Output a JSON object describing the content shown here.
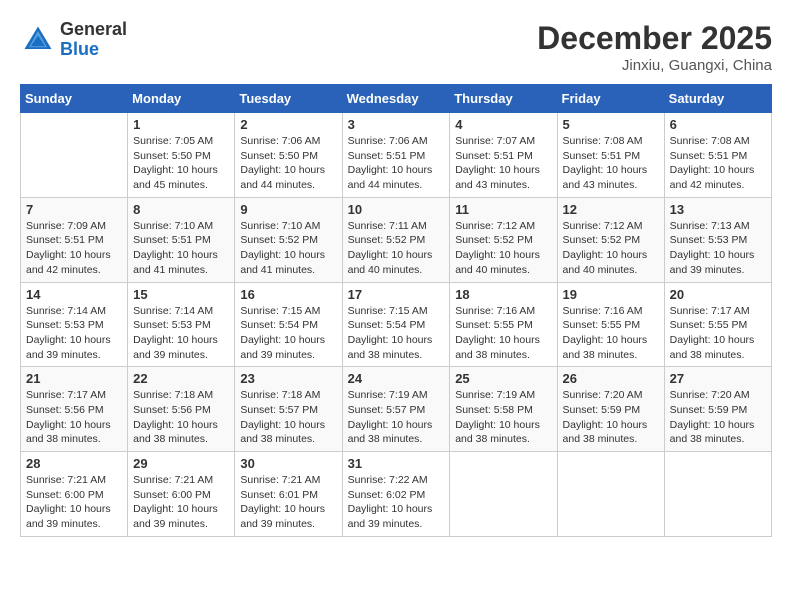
{
  "header": {
    "logo_general": "General",
    "logo_blue": "Blue",
    "month_year": "December 2025",
    "location": "Jinxiu, Guangxi, China"
  },
  "weekdays": [
    "Sunday",
    "Monday",
    "Tuesday",
    "Wednesday",
    "Thursday",
    "Friday",
    "Saturday"
  ],
  "weeks": [
    [
      {
        "day": "",
        "sunrise": "",
        "sunset": "",
        "daylight": ""
      },
      {
        "day": "1",
        "sunrise": "Sunrise: 7:05 AM",
        "sunset": "Sunset: 5:50 PM",
        "daylight": "Daylight: 10 hours and 45 minutes."
      },
      {
        "day": "2",
        "sunrise": "Sunrise: 7:06 AM",
        "sunset": "Sunset: 5:50 PM",
        "daylight": "Daylight: 10 hours and 44 minutes."
      },
      {
        "day": "3",
        "sunrise": "Sunrise: 7:06 AM",
        "sunset": "Sunset: 5:51 PM",
        "daylight": "Daylight: 10 hours and 44 minutes."
      },
      {
        "day": "4",
        "sunrise": "Sunrise: 7:07 AM",
        "sunset": "Sunset: 5:51 PM",
        "daylight": "Daylight: 10 hours and 43 minutes."
      },
      {
        "day": "5",
        "sunrise": "Sunrise: 7:08 AM",
        "sunset": "Sunset: 5:51 PM",
        "daylight": "Daylight: 10 hours and 43 minutes."
      },
      {
        "day": "6",
        "sunrise": "Sunrise: 7:08 AM",
        "sunset": "Sunset: 5:51 PM",
        "daylight": "Daylight: 10 hours and 42 minutes."
      }
    ],
    [
      {
        "day": "7",
        "sunrise": "Sunrise: 7:09 AM",
        "sunset": "Sunset: 5:51 PM",
        "daylight": "Daylight: 10 hours and 42 minutes."
      },
      {
        "day": "8",
        "sunrise": "Sunrise: 7:10 AM",
        "sunset": "Sunset: 5:51 PM",
        "daylight": "Daylight: 10 hours and 41 minutes."
      },
      {
        "day": "9",
        "sunrise": "Sunrise: 7:10 AM",
        "sunset": "Sunset: 5:52 PM",
        "daylight": "Daylight: 10 hours and 41 minutes."
      },
      {
        "day": "10",
        "sunrise": "Sunrise: 7:11 AM",
        "sunset": "Sunset: 5:52 PM",
        "daylight": "Daylight: 10 hours and 40 minutes."
      },
      {
        "day": "11",
        "sunrise": "Sunrise: 7:12 AM",
        "sunset": "Sunset: 5:52 PM",
        "daylight": "Daylight: 10 hours and 40 minutes."
      },
      {
        "day": "12",
        "sunrise": "Sunrise: 7:12 AM",
        "sunset": "Sunset: 5:52 PM",
        "daylight": "Daylight: 10 hours and 40 minutes."
      },
      {
        "day": "13",
        "sunrise": "Sunrise: 7:13 AM",
        "sunset": "Sunset: 5:53 PM",
        "daylight": "Daylight: 10 hours and 39 minutes."
      }
    ],
    [
      {
        "day": "14",
        "sunrise": "Sunrise: 7:14 AM",
        "sunset": "Sunset: 5:53 PM",
        "daylight": "Daylight: 10 hours and 39 minutes."
      },
      {
        "day": "15",
        "sunrise": "Sunrise: 7:14 AM",
        "sunset": "Sunset: 5:53 PM",
        "daylight": "Daylight: 10 hours and 39 minutes."
      },
      {
        "day": "16",
        "sunrise": "Sunrise: 7:15 AM",
        "sunset": "Sunset: 5:54 PM",
        "daylight": "Daylight: 10 hours and 39 minutes."
      },
      {
        "day": "17",
        "sunrise": "Sunrise: 7:15 AM",
        "sunset": "Sunset: 5:54 PM",
        "daylight": "Daylight: 10 hours and 38 minutes."
      },
      {
        "day": "18",
        "sunrise": "Sunrise: 7:16 AM",
        "sunset": "Sunset: 5:55 PM",
        "daylight": "Daylight: 10 hours and 38 minutes."
      },
      {
        "day": "19",
        "sunrise": "Sunrise: 7:16 AM",
        "sunset": "Sunset: 5:55 PM",
        "daylight": "Daylight: 10 hours and 38 minutes."
      },
      {
        "day": "20",
        "sunrise": "Sunrise: 7:17 AM",
        "sunset": "Sunset: 5:55 PM",
        "daylight": "Daylight: 10 hours and 38 minutes."
      }
    ],
    [
      {
        "day": "21",
        "sunrise": "Sunrise: 7:17 AM",
        "sunset": "Sunset: 5:56 PM",
        "daylight": "Daylight: 10 hours and 38 minutes."
      },
      {
        "day": "22",
        "sunrise": "Sunrise: 7:18 AM",
        "sunset": "Sunset: 5:56 PM",
        "daylight": "Daylight: 10 hours and 38 minutes."
      },
      {
        "day": "23",
        "sunrise": "Sunrise: 7:18 AM",
        "sunset": "Sunset: 5:57 PM",
        "daylight": "Daylight: 10 hours and 38 minutes."
      },
      {
        "day": "24",
        "sunrise": "Sunrise: 7:19 AM",
        "sunset": "Sunset: 5:57 PM",
        "daylight": "Daylight: 10 hours and 38 minutes."
      },
      {
        "day": "25",
        "sunrise": "Sunrise: 7:19 AM",
        "sunset": "Sunset: 5:58 PM",
        "daylight": "Daylight: 10 hours and 38 minutes."
      },
      {
        "day": "26",
        "sunrise": "Sunrise: 7:20 AM",
        "sunset": "Sunset: 5:59 PM",
        "daylight": "Daylight: 10 hours and 38 minutes."
      },
      {
        "day": "27",
        "sunrise": "Sunrise: 7:20 AM",
        "sunset": "Sunset: 5:59 PM",
        "daylight": "Daylight: 10 hours and 38 minutes."
      }
    ],
    [
      {
        "day": "28",
        "sunrise": "Sunrise: 7:21 AM",
        "sunset": "Sunset: 6:00 PM",
        "daylight": "Daylight: 10 hours and 39 minutes."
      },
      {
        "day": "29",
        "sunrise": "Sunrise: 7:21 AM",
        "sunset": "Sunset: 6:00 PM",
        "daylight": "Daylight: 10 hours and 39 minutes."
      },
      {
        "day": "30",
        "sunrise": "Sunrise: 7:21 AM",
        "sunset": "Sunset: 6:01 PM",
        "daylight": "Daylight: 10 hours and 39 minutes."
      },
      {
        "day": "31",
        "sunrise": "Sunrise: 7:22 AM",
        "sunset": "Sunset: 6:02 PM",
        "daylight": "Daylight: 10 hours and 39 minutes."
      },
      {
        "day": "",
        "sunrise": "",
        "sunset": "",
        "daylight": ""
      },
      {
        "day": "",
        "sunrise": "",
        "sunset": "",
        "daylight": ""
      },
      {
        "day": "",
        "sunrise": "",
        "sunset": "",
        "daylight": ""
      }
    ]
  ]
}
